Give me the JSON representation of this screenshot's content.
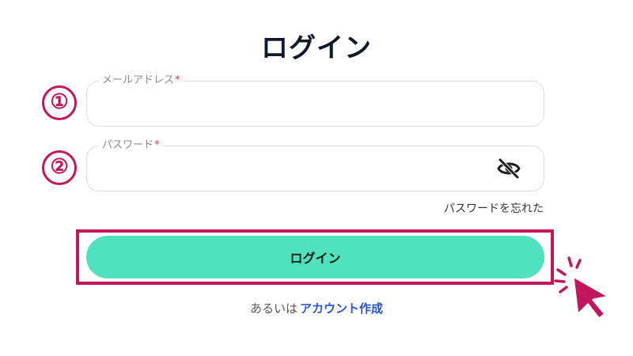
{
  "header": {
    "title": "ログイン"
  },
  "steps": {
    "email_marker": "①",
    "password_marker": "②"
  },
  "email_field": {
    "label": "メールアドレス",
    "required_mark": "*",
    "value": ""
  },
  "password_field": {
    "label": "パスワード",
    "required_mark": "*",
    "value": "",
    "toggle_icon": "eye-slash-icon"
  },
  "forgot_password": {
    "label": "パスワードを忘れた"
  },
  "login_button": {
    "label": "ログイン"
  },
  "signup": {
    "prefix": "あるいは",
    "link_label": "アカウント作成"
  },
  "colors": {
    "accent_magenta": "#c2185b",
    "button_green": "#4fe3bd",
    "link_blue": "#2553d9",
    "required_red": "#d23b5a"
  },
  "icons": {
    "cursor": "pointer-cursor-icon"
  }
}
